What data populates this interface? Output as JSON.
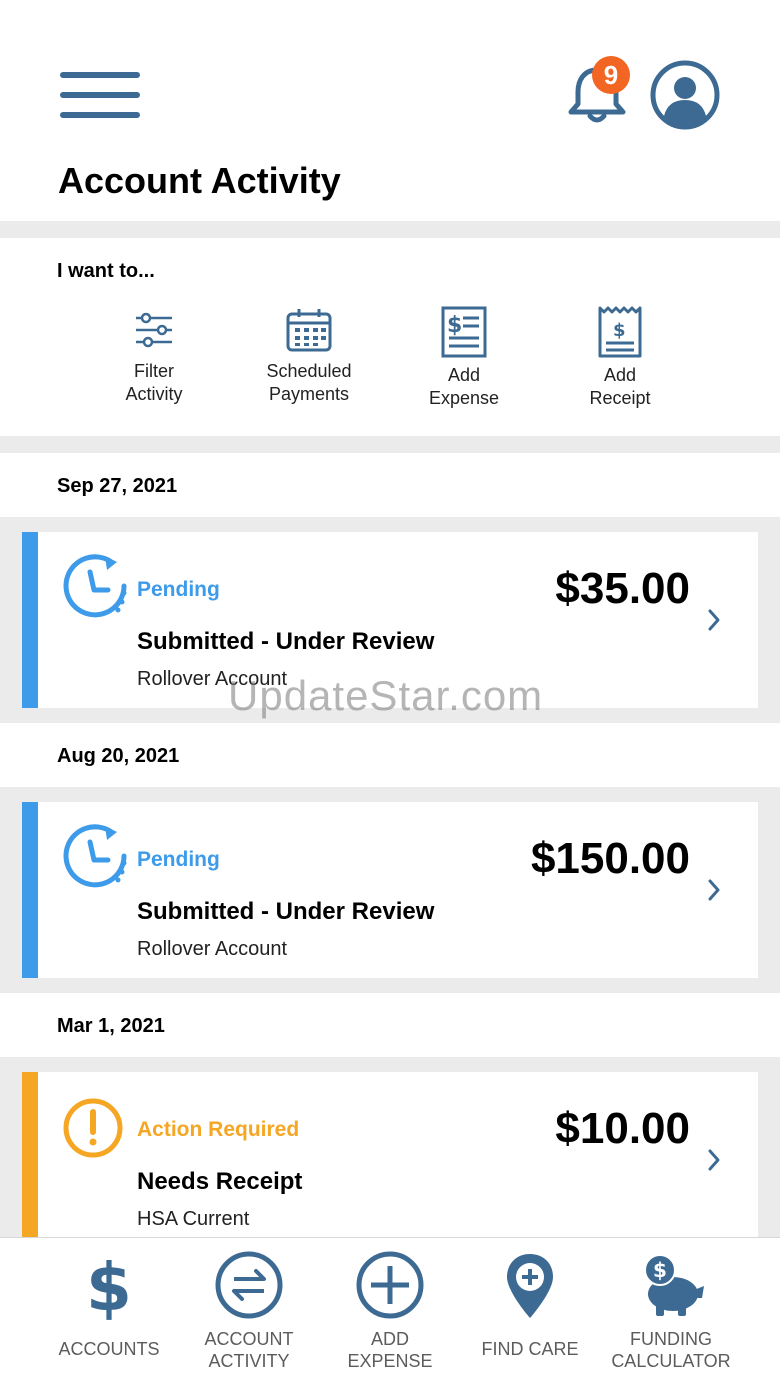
{
  "header": {
    "title": "Account Activity",
    "notification_count": "9",
    "menu_icon": "hamburger-menu-icon",
    "avatar_icon": "user-avatar-icon"
  },
  "quick_actions": {
    "label": "I want to...",
    "items": [
      {
        "line1": "Filter",
        "line2": "Activity",
        "icon": "sliders-icon"
      },
      {
        "line1": "Scheduled",
        "line2": "Payments",
        "icon": "calendar-icon"
      },
      {
        "line1": "Add",
        "line2": "Expense",
        "icon": "document-dollar-icon"
      },
      {
        "line1": "Add",
        "line2": "Receipt",
        "icon": "receipt-icon"
      }
    ]
  },
  "activity": [
    {
      "date": "Sep 27, 2021",
      "status": "Pending",
      "amount": "$35.00",
      "description": "Submitted - Under Review",
      "account": "Rollover Account",
      "status_color": "#3d9be9"
    },
    {
      "date": "Aug 20, 2021",
      "status": "Pending",
      "amount": "$150.00",
      "description": "Submitted - Under Review",
      "account": "Rollover Account",
      "status_color": "#3d9be9"
    },
    {
      "date": "Mar 1, 2021",
      "status": "Action Required",
      "amount": "$10.00",
      "description": "Needs Receipt",
      "account": "HSA Current",
      "status_color": "#f5a623"
    }
  ],
  "watermark": "UpdateStar.com",
  "tabbar": {
    "items": [
      {
        "line1": "ACCOUNTS",
        "line2": "",
        "icon": "dollar-icon"
      },
      {
        "line1": "ACCOUNT",
        "line2": "ACTIVITY",
        "icon": "exchange-arrows-icon"
      },
      {
        "line1": "ADD",
        "line2": "EXPENSE",
        "icon": "plus-circle-icon"
      },
      {
        "line1": "FIND CARE",
        "line2": "",
        "icon": "location-plus-icon"
      },
      {
        "line1": "FUNDING",
        "line2": "CALCULATOR",
        "icon": "piggy-bank-icon"
      }
    ]
  },
  "colors": {
    "brand": "#3d6a93",
    "pending": "#3d9be9",
    "warning": "#f5a623",
    "badge": "#f26522"
  }
}
